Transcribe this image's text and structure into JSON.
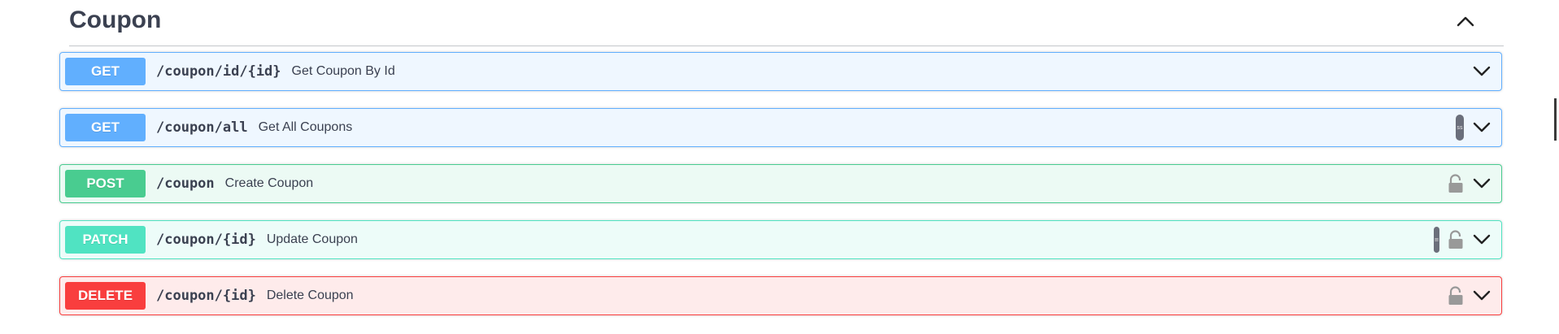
{
  "section": {
    "title": "Coupon",
    "collapse_icon": "chevron-up-icon"
  },
  "operations": [
    {
      "method": "GET",
      "path": "/coupon/id/{id}",
      "summary": "Get Coupon By Id",
      "color": "#61affe",
      "has_lock": false,
      "has_pill": false
    },
    {
      "method": "GET",
      "path": "/coupon/all",
      "summary": "Get All Coupons",
      "color": "#61affe",
      "has_lock": false,
      "has_pill": true,
      "pill_text": "ss"
    },
    {
      "method": "POST",
      "path": "/coupon",
      "summary": "Create Coupon",
      "color": "#49cc90",
      "has_lock": true,
      "has_pill": false
    },
    {
      "method": "PATCH",
      "path": "/coupon/{id}",
      "summary": "Update Coupon",
      "color": "#50e3c2",
      "has_lock": true,
      "has_pill": true,
      "pill_text": "≡"
    },
    {
      "method": "DELETE",
      "path": "/coupon/{id}",
      "summary": "Delete Coupon",
      "color": "#f93e3e",
      "has_lock": true,
      "has_pill": false
    }
  ]
}
